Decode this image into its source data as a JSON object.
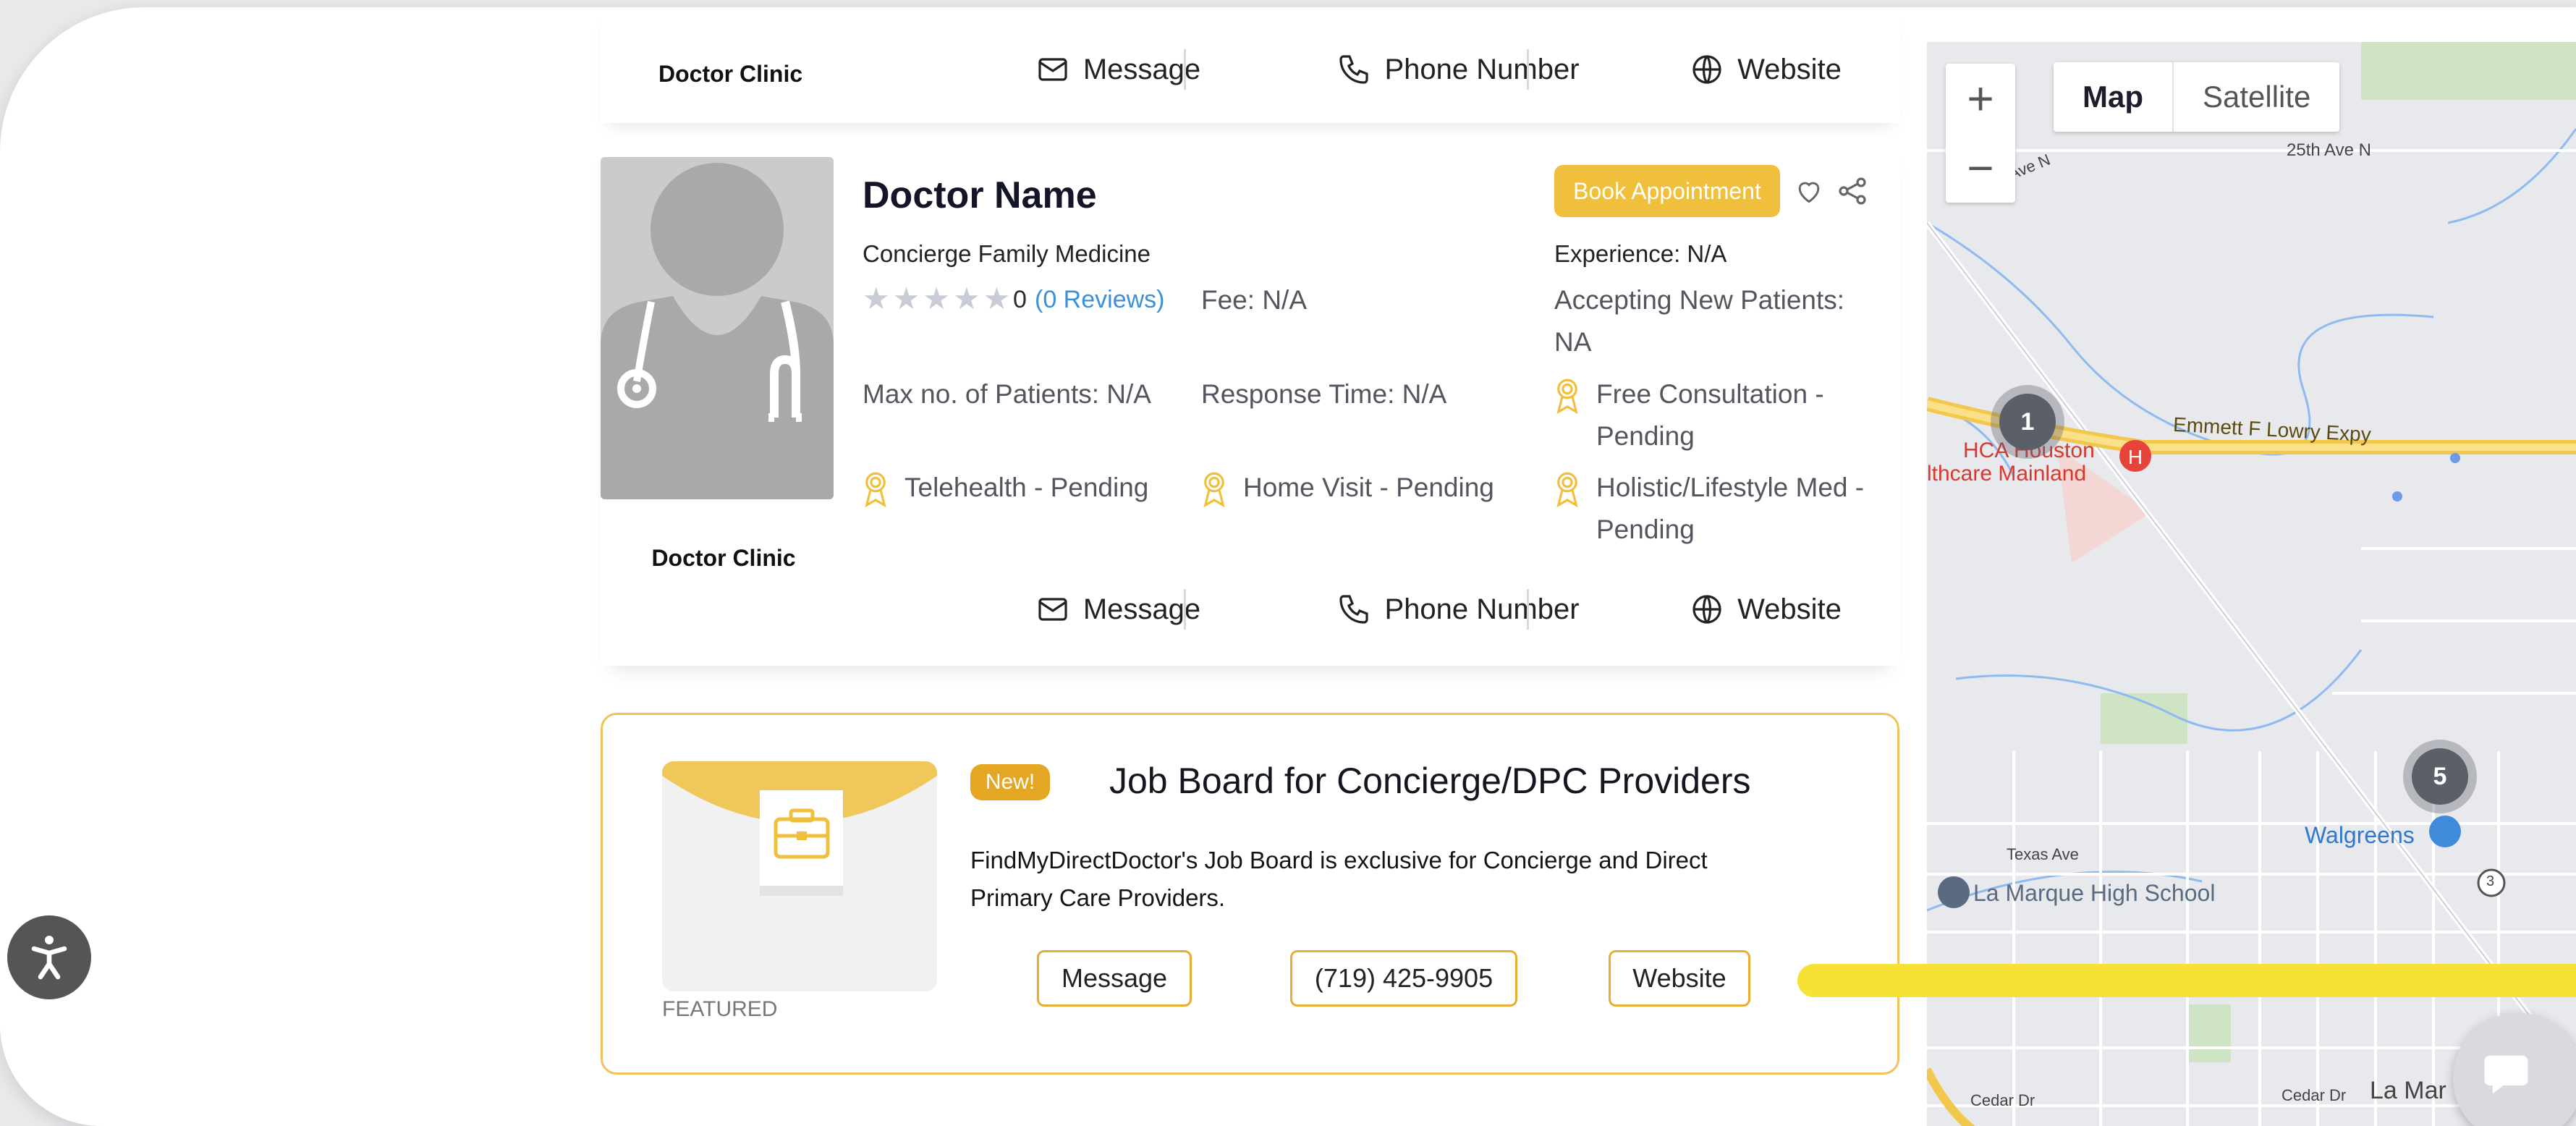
{
  "top_strip": {
    "clinic": "Doctor Clinic",
    "message": "Message",
    "phone": "Phone Number",
    "website": "Website"
  },
  "doctor": {
    "name": "Doctor Name",
    "specialty": "Concierge Family Medicine",
    "book_label": "Book Appointment",
    "rating": "0",
    "reviews": "(0 Reviews)",
    "stars_filled": 0,
    "stars_total": 5,
    "fee": "Fee: N/A",
    "experience": "Experience: N/A",
    "accepting": "Accepting New Patients: NA",
    "max_patients": "Max no. of Patients: N/A",
    "response_time": "Response Time: N/A",
    "free_consult": "Free Consultation - Pending",
    "telehealth": "Telehealth - Pending",
    "home_visit": "Home Visit - Pending",
    "holistic": "Holistic/Lifestyle Med - Pending",
    "clinic": "Doctor Clinic",
    "message": "Message",
    "phone": "Phone Number",
    "website": "Website"
  },
  "job": {
    "new_badge": "New!",
    "title": "Job Board for Concierge/DPC Providers",
    "description": "FindMyDirectDoctor's Job Board is exclusive for Concierge and Direct Primary Care Providers.",
    "featured": "FEATURED",
    "message": "Message",
    "phone": "(719) 425-9905",
    "website": "Website"
  },
  "map": {
    "zoom_in": "+",
    "zoom_out": "−",
    "type_map": "Map",
    "type_satellite": "Satellite",
    "labels": {
      "ave25": "25th Ave N",
      "ave_n": "Ave N",
      "emmett": "Emmett F Lowry Expy",
      "hca1": "HCA Houston",
      "hca2": "lthcare Mainland",
      "texas_ave": "Texas Ave",
      "walgreens": "Walgreens",
      "school": "La Marque High School",
      "route3": "3",
      "cedar1": "Cedar Dr",
      "cedar2": "Cedar Dr",
      "la_marque": "La Mar"
    },
    "clusters": [
      "1",
      "5"
    ]
  },
  "colors": {
    "accent": "#f0bf3b",
    "link": "#3d8fd8",
    "job_border": "#efc35a",
    "new_badge": "#e4a623"
  }
}
